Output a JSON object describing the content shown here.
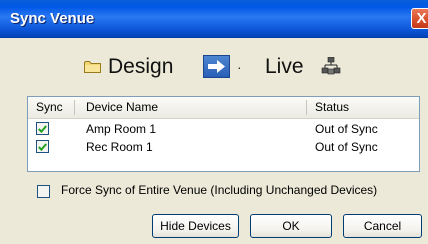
{
  "window": {
    "title": "Sync Venue",
    "close_glyph": "X"
  },
  "direction": {
    "source_label": "Design",
    "target_label": "Live",
    "source_icon": "folder-icon",
    "arrow_icon": "arrow-right-icon",
    "dropdown_icon": "dropdown-dot-icon",
    "target_icon": "network-icon",
    "dropdown_glyph": "·"
  },
  "device_list": {
    "columns": [
      "Sync",
      "Device Name",
      "Status"
    ],
    "rows": [
      {
        "sync": true,
        "device_name": "Amp Room 1",
        "status": "Out of Sync"
      },
      {
        "sync": true,
        "device_name": "Rec Room 1",
        "status": "Out of Sync"
      }
    ]
  },
  "force_sync": {
    "checked": false,
    "label": "Force Sync of Entire Venue (Including Unchanged Devices)"
  },
  "buttons": {
    "hide_devices": "Hide Devices",
    "ok": "OK",
    "cancel": "Cancel"
  },
  "colors": {
    "titlebar": "#0058e6",
    "dialog_bg": "#ece9d8",
    "check": "#21a121",
    "close_button": "#d9502d"
  }
}
